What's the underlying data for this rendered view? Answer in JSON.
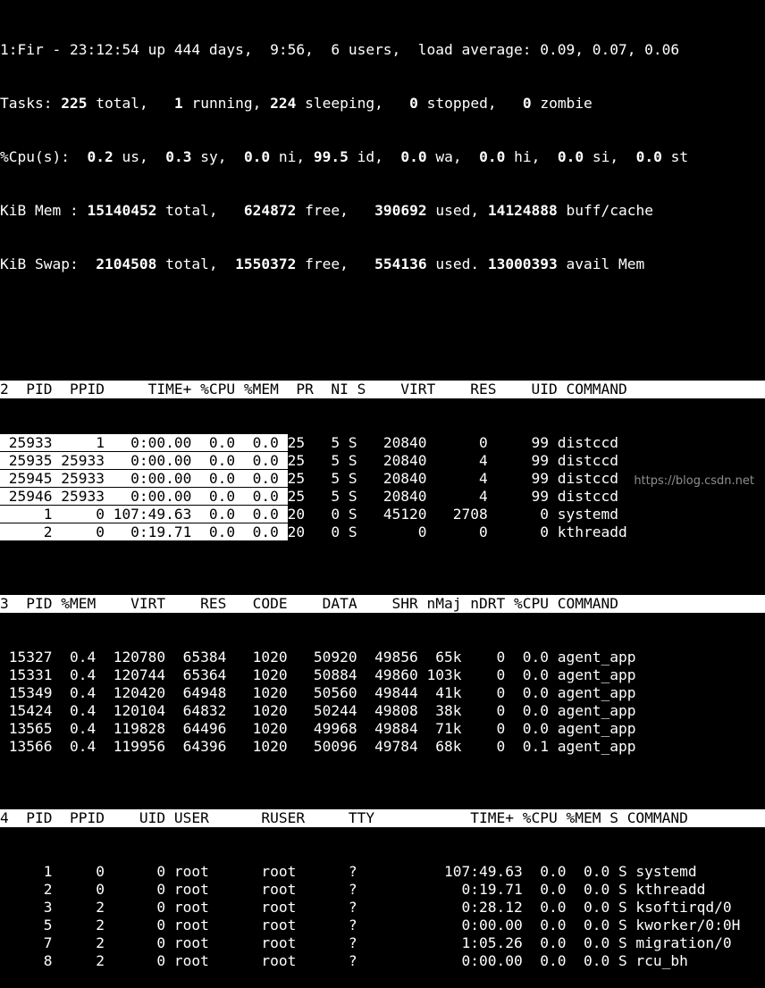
{
  "summary": {
    "line1": "1:Fir - 23:12:54 up 444 days,  9:56,  6 users,  load average: 0.09, 0.07, 0.06",
    "tasks": {
      "prefix": "Tasks: ",
      "total": "225",
      "s1": " total,   ",
      "running": "1",
      "s2": " running, ",
      "sleeping": "224",
      "s3": " sleeping,   ",
      "stopped": "0",
      "s4": " stopped,   ",
      "zombie": "0",
      "s5": " zombie"
    },
    "cpu": {
      "prefix": "%Cpu(s):  ",
      "us": "0.2",
      "s1": " us,  ",
      "sy": "0.3",
      "s2": " sy,  ",
      "ni": "0.0",
      "s3": " ni, ",
      "id": "99.5",
      "s4": " id,  ",
      "wa": "0.0",
      "s5": " wa,  ",
      "hi": "0.0",
      "s6": " hi,  ",
      "si": "0.0",
      "s7": " si,  ",
      "st": "0.0",
      "s8": " st"
    },
    "mem": {
      "prefix": "KiB Mem : ",
      "total": "15140452",
      "s1": " total,   ",
      "free": "624872",
      "s2": " free,   ",
      "used": "390692",
      "s3": " used, ",
      "cache": "14124888",
      "s4": " buff/cache"
    },
    "swap": {
      "prefix": "KiB Swap:  ",
      "total": "2104508",
      "s1": " total,  ",
      "free": "1550372",
      "s2": " free,   ",
      "used": "554136",
      "s3": " used. ",
      "avail": "13000393",
      "s4": " avail Mem"
    }
  },
  "window2": {
    "header": "2  PID  PPID     TIME+ %CPU %MEM  PR  NI S    VIRT    RES    UID COMMAND",
    "rows": [
      {
        "a": " 25933     1   0:00.00  0.0  0.0 ",
        "pr": "25",
        "b": "   5 S   20840      0     99 distccd"
      },
      {
        "a": " 25935 25933   0:00.00  0.0  0.0 ",
        "pr": "25",
        "b": "   5 S   20840      4     99 distccd"
      },
      {
        "a": " 25945 25933   0:00.00  0.0  0.0 ",
        "pr": "25",
        "b": "   5 S   20840      4     99 distccd"
      },
      {
        "a": " 25946 25933   0:00.00  0.0  0.0 ",
        "pr": "25",
        "b": "   5 S   20840      4     99 distccd"
      },
      {
        "a": "     1     0 107:49.63  0.0  0.0 ",
        "pr": "20",
        "b": "   0 S   45120   2708      0 systemd"
      },
      {
        "a": "     2     0   0:19.71  0.0  0.0 ",
        "pr": "20",
        "b": "   0 S       0      0      0 kthreadd"
      }
    ]
  },
  "window3": {
    "header": "3  PID %MEM    VIRT    RES   CODE    DATA    SHR nMaj nDRT %CPU COMMAND",
    "rows": [
      " 15327  0.4  120780  65384   1020   50920  49856  65k    0  0.0 agent_app",
      " 15331  0.4  120744  65364   1020   50884  49860 103k    0  0.0 agent_app",
      " 15349  0.4  120420  64948   1020   50560  49844  41k    0  0.0 agent_app",
      " 15424  0.4  120104  64832   1020   50244  49808  38k    0  0.0 agent_app",
      " 13565  0.4  119828  64496   1020   49968  49884  71k    0  0.0 agent_app",
      " 13566  0.4  119956  64396   1020   50096  49784  68k    0  0.1 agent_app"
    ]
  },
  "window4": {
    "header": "4  PID  PPID    UID USER      RUSER     TTY           TIME+ %CPU %MEM S COMMAND",
    "rows": [
      "     1     0      0 root      root      ?          107:49.63  0.0  0.0 S systemd",
      "     2     0      0 root      root      ?            0:19.71  0.0  0.0 S kthreadd",
      "     3     2      0 root      root      ?            0:28.12  0.0  0.0 S ksoftirqd/0",
      "     5     2      0 root      root      ?            0:00.00  0.0  0.0 S kworker/0:0H",
      "     7     2      0 root      root      ?            1:05.26  0.0  0.0 S migration/0",
      "     8     2      0 root      root      ?            0:00.00  0.0  0.0 S rcu_bh"
    ]
  },
  "watermark": "https://blog.csdn.net"
}
